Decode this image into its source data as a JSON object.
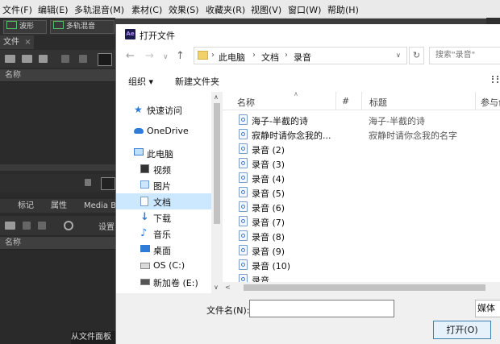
{
  "menu": [
    "文件(F)",
    "编辑(E)",
    "多轨混音(M)",
    "素材(C)",
    "效果(S)",
    "收藏夹(R)",
    "视图(V)",
    "窗口(W)",
    "帮助(H)"
  ],
  "toolbar": {
    "waveform_label": "波形",
    "multitrack_label": "多轨混音"
  },
  "files_panel": {
    "tab_label": "文件",
    "close_glyph": "×",
    "column_name": "名称"
  },
  "lower_panel": {
    "tabs": [
      "标记",
      "属性",
      "Media Br"
    ],
    "settings_label": "设置",
    "column_name": "名称",
    "status_text": "从文件面板"
  },
  "dialog": {
    "app_icon_text": "Ae",
    "title": "打开文件",
    "breadcrumb": [
      "此电脑",
      "文档",
      "录音"
    ],
    "search_placeholder": "搜索\"录音\"",
    "organize_label": "组织 ▾",
    "new_folder_label": "新建文件夹",
    "nav_items": [
      {
        "label": "快速访问",
        "icon": "star-icon"
      },
      {
        "label": "OneDrive",
        "icon": "cloud-icon"
      },
      {
        "label": "此电脑",
        "icon": "computer-icon"
      },
      {
        "label": "视频",
        "icon": "video-icon"
      },
      {
        "label": "图片",
        "icon": "picture-icon"
      },
      {
        "label": "文档",
        "icon": "document-icon"
      },
      {
        "label": "下载",
        "icon": "download-icon"
      },
      {
        "label": "音乐",
        "icon": "music-icon"
      },
      {
        "label": "桌面",
        "icon": "desktop-icon"
      },
      {
        "label": "OS (C:)",
        "icon": "drive-icon"
      },
      {
        "label": "新加卷 (E:)",
        "icon": "drive-icon"
      }
    ],
    "columns": [
      "名称",
      "#",
      "标题",
      "参与创"
    ],
    "files": [
      {
        "name": "海子-半截的诗",
        "title": "海子-半截的诗"
      },
      {
        "name": "寂静时请你念我的...",
        "title": "寂静时请你念我的名字"
      },
      {
        "name": "录音 (2)",
        "title": ""
      },
      {
        "name": "录音 (3)",
        "title": ""
      },
      {
        "name": "录音 (4)",
        "title": ""
      },
      {
        "name": "录音 (5)",
        "title": ""
      },
      {
        "name": "录音 (6)",
        "title": ""
      },
      {
        "name": "录音 (7)",
        "title": ""
      },
      {
        "name": "录音 (8)",
        "title": ""
      },
      {
        "name": "录音 (9)",
        "title": ""
      },
      {
        "name": "录音 (10)",
        "title": ""
      },
      {
        "name": "录音",
        "title": ""
      }
    ],
    "filename_label": "文件名(N):",
    "filename_value": "",
    "file_type_label": "媒体",
    "open_button": "打开(O)"
  }
}
